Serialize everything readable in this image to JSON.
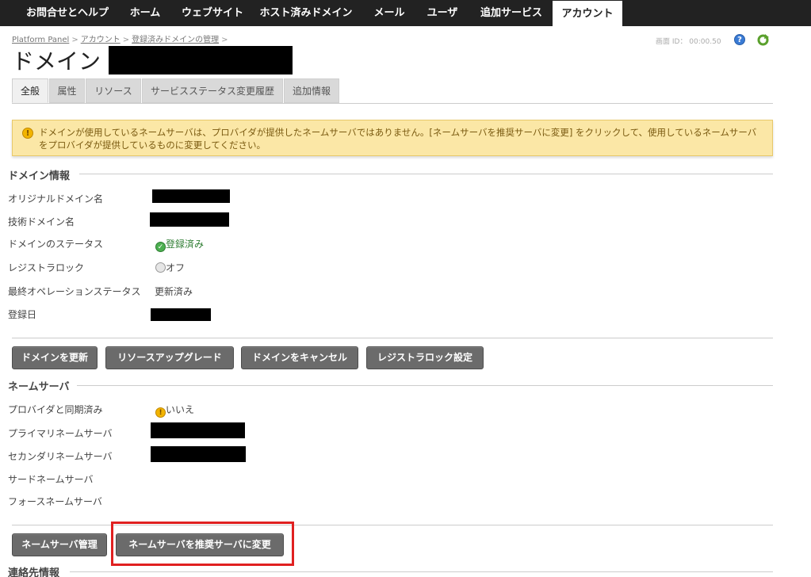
{
  "nav": {
    "items": [
      "お問合せとヘルプ",
      "ホーム",
      "ウェブサイト",
      "ホスト済みドメイン",
      "メール",
      "ユーザ",
      "追加サービス",
      "アカウント"
    ],
    "active": "アカウント"
  },
  "breadcrumb": [
    "Platform Panel",
    "アカウント",
    "登録済みドメインの管理"
  ],
  "screen_id": "画面 ID： 00:00.50",
  "page_title": "ドメイン",
  "tabs": [
    "全般",
    "属性",
    "リソース",
    "サービスステータス変更履歴",
    "追加情報"
  ],
  "warning_text": "ドメインが使用しているネームサーバは、プロバイダが提供したネームサーバではありません。[ネームサーバを推奨サーバに変更] をクリックして、使用しているネームサーバをプロバイダが提供しているものに変更してください。",
  "domain_info": {
    "title": "ドメイン情報",
    "labels": {
      "original_name": "オリジナルドメイン名",
      "tech_name": "技術ドメイン名",
      "status": "ドメインのステータス",
      "registrar_lock": "レジストラロック",
      "last_op": "最終オペレーションステータス",
      "registered": "登録日"
    },
    "values": {
      "status": "登録済み",
      "registrar_lock": "オフ",
      "last_op": "更新済み"
    }
  },
  "domain_buttons": [
    "ドメインを更新",
    "リソースアップグレード",
    "ドメインをキャンセル",
    "レジストラロック設定"
  ],
  "nameservers": {
    "title": "ネームサーバ",
    "labels": {
      "synced": "プロバイダと同期済み",
      "primary": "プライマリネームサーバ",
      "secondary": "セカンダリネームサーバ",
      "third": "サードネームサーバ",
      "fourth": "フォースネームサーバ"
    },
    "values": {
      "synced": "いいえ"
    }
  },
  "ns_buttons": [
    "ネームサーバ管理",
    "ネームサーバを推奨サーバに変更"
  ],
  "contact_title": "連絡先情報",
  "icons": {
    "help": "help-icon",
    "refresh": "refresh-icon",
    "warning": "warning-icon"
  }
}
